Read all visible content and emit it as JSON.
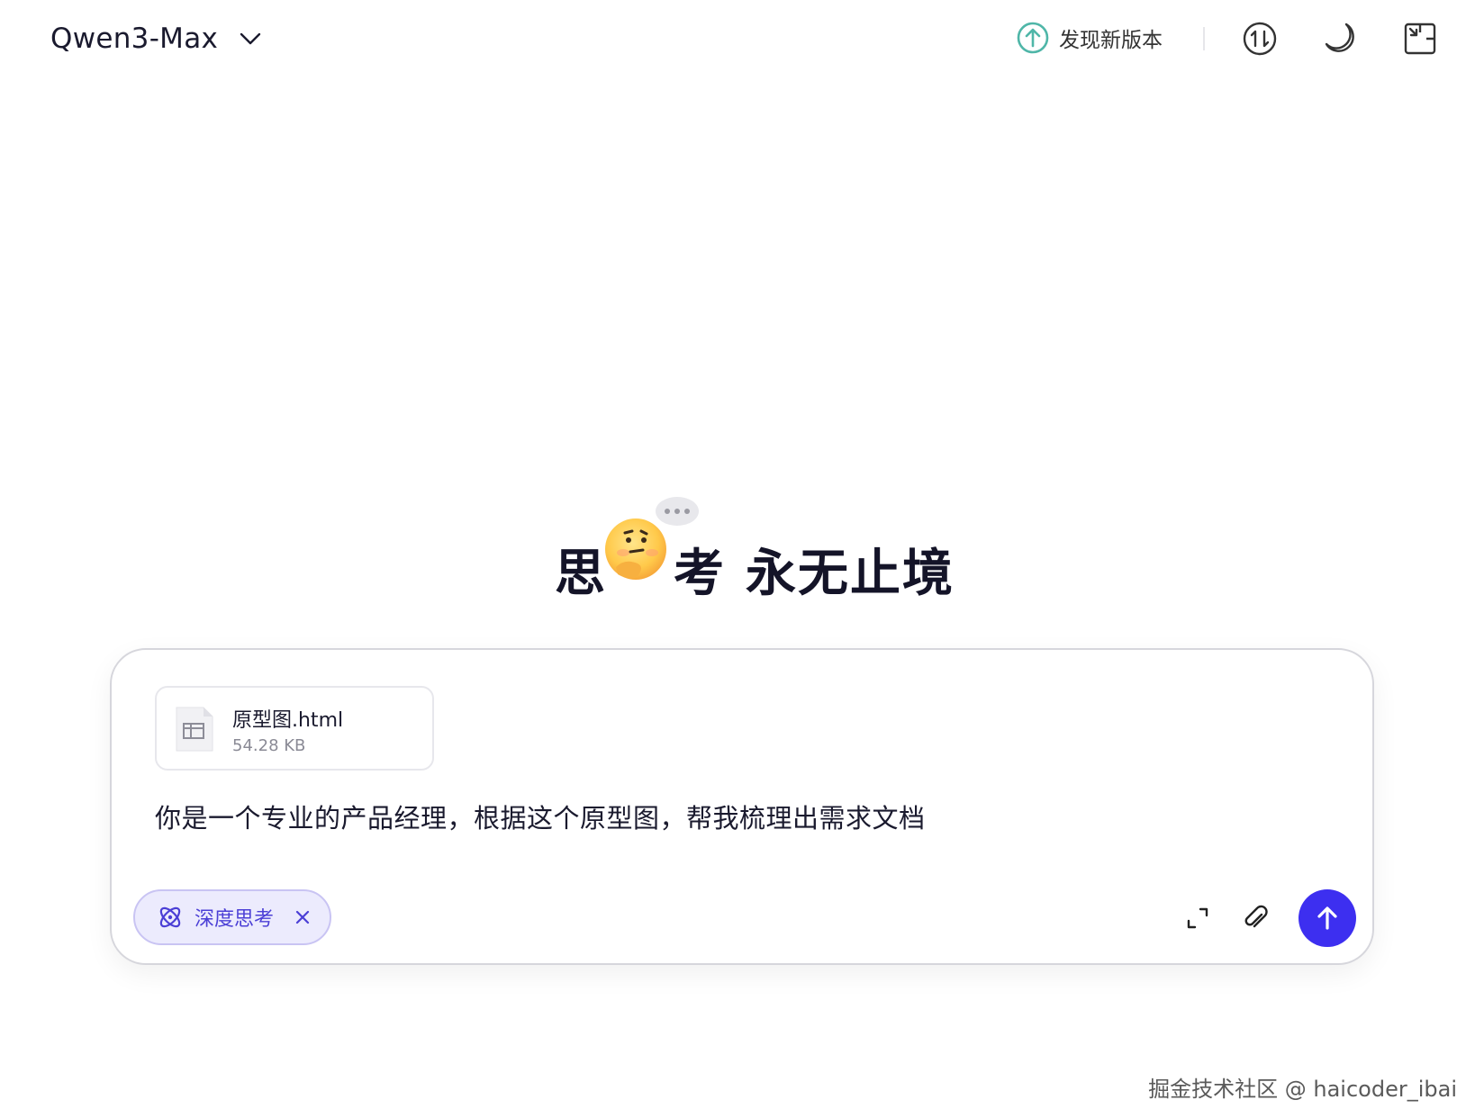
{
  "header": {
    "model_name": "Qwen3-Max",
    "update_label": "发现新版本"
  },
  "hero": {
    "title_first": "思",
    "title_second": "考",
    "title_rest": "永无止境"
  },
  "composer": {
    "attachment": {
      "name": "原型图.html",
      "size": "54.28 KB"
    },
    "prompt": "你是一个专业的产品经理，根据这个原型图，帮我梳理出需求文档",
    "deep_think_label": "深度思考"
  },
  "watermark": "掘金技术社区 @ haicoder_ibai",
  "colors": {
    "accent": "#3d2ff0",
    "chip_bg": "#ecebfd",
    "chip_text": "#4b3fd6",
    "update_icon": "#4fb6a8"
  },
  "icons": {
    "model_dropdown": "chevron-down-icon",
    "update": "arrow-up-circle-icon",
    "sync": "sync-icon",
    "theme": "moon-icon",
    "layout": "collapse-window-icon",
    "file": "html-file-icon",
    "deep_think": "atom-icon",
    "chip_close": "close-icon",
    "expand": "expand-icon",
    "attach": "paperclip-icon",
    "send": "arrow-up-icon"
  }
}
